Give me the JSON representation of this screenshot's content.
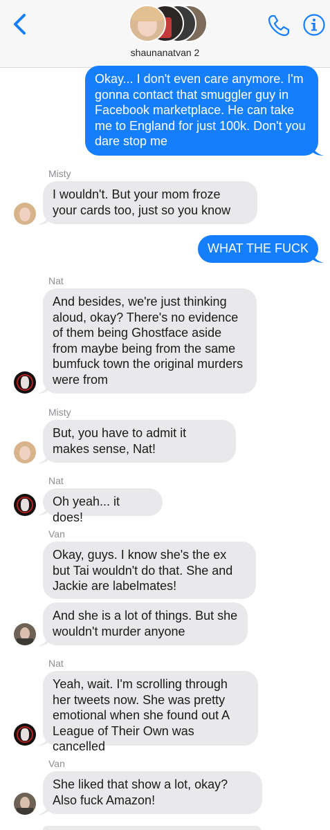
{
  "header": {
    "group_name": "shaunanatvan 2",
    "back_icon": "chevron-left-icon",
    "call_icon": "phone-icon",
    "info_icon": "info-icon",
    "accent_color": "#147efb"
  },
  "messages": [
    {
      "type": "out",
      "text": "Okay... I don't even care anymore. I'm gonna contact that smuggler guy in Facebook marketplace. He can take me to England for just 100k. Don't you dare stop me"
    },
    {
      "type": "in",
      "sender": "Misty",
      "text": "I wouldn't. But your mom froze your cards too, just so you know"
    },
    {
      "type": "out",
      "text": "WHAT THE FUCK"
    },
    {
      "type": "in",
      "sender": "Nat",
      "text": "And besides, we're just thinking aloud, okay? There's no evidence of them being Ghostface aside from maybe being from the same bumfuck town the original murders were from"
    },
    {
      "type": "in",
      "sender": "Misty",
      "text": "But, you have to admit it makes sense, Nat!"
    },
    {
      "type": "in",
      "sender": "Nat",
      "text": "Oh yeah... it does!"
    },
    {
      "type": "in",
      "sender": "Van",
      "text": "Okay, guys. I know she's the ex but Tai wouldn't do that. She and Jackie are labelmates!"
    },
    {
      "type": "in",
      "text": "And she is a lot of things. But she wouldn't murder anyone"
    },
    {
      "type": "in",
      "sender": "Nat",
      "text": "Yeah, wait. I'm scrolling through her tweets now. She was pretty emotional when she found out A League of Their Own was cancelled"
    },
    {
      "type": "in",
      "sender": "Van",
      "text": "She liked that show a lot, okay? Also fuck Amazon!"
    }
  ]
}
